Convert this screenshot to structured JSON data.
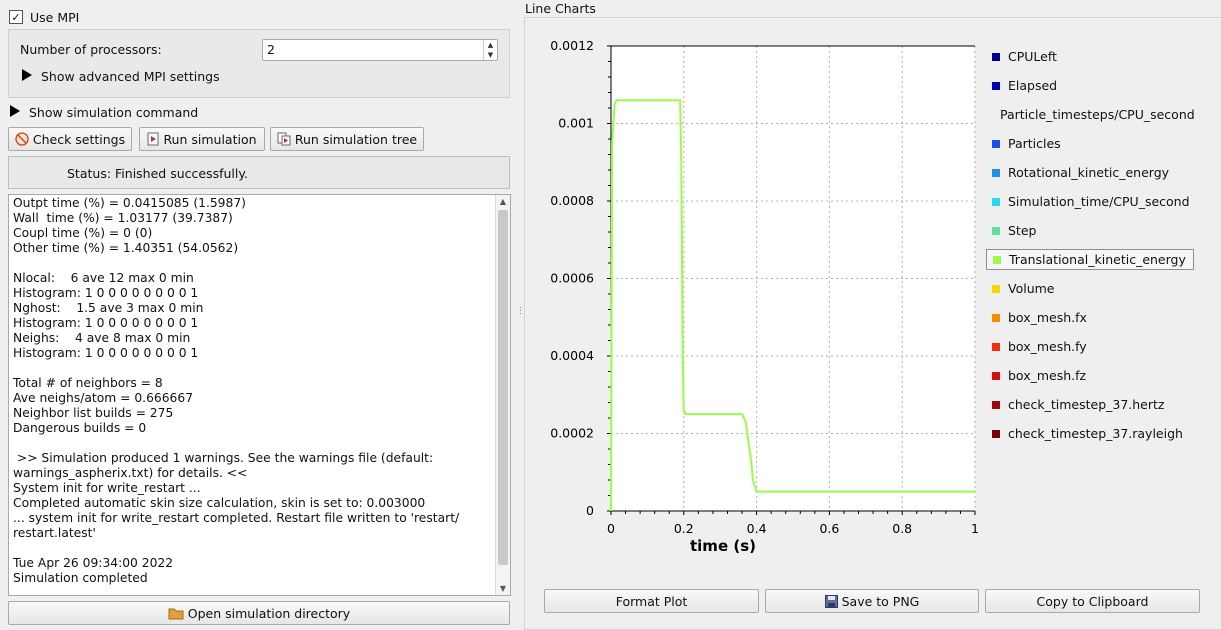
{
  "mpi": {
    "use_mpi_label": "Use MPI",
    "use_mpi_checked": true,
    "check_mark": "✓",
    "processors_label": "Number of processors:",
    "processors_value": "2",
    "advanced_label": "Show advanced MPI settings"
  },
  "simulation_command_label": "Show simulation command",
  "toolbar": {
    "check_settings": "Check settings",
    "run_simulation": "Run simulation",
    "run_simulation_tree": "Run simulation tree"
  },
  "status_text": "Status: Finished successfully.",
  "log_lines": [
    "Outpt time (%) = 0.0415085 (1.5987)",
    "Wall  time (%) = 1.03177 (39.7387)",
    "Coupl time (%) = 0 (0)",
    "Other time (%) = 1.40351 (54.0562)",
    "",
    "Nlocal:    6 ave 12 max 0 min",
    "Histogram: 1 0 0 0 0 0 0 0 0 1",
    "Nghost:    1.5 ave 3 max 0 min",
    "Histogram: 1 0 0 0 0 0 0 0 0 1",
    "Neighs:    4 ave 8 max 0 min",
    "Histogram: 1 0 0 0 0 0 0 0 0 1",
    "",
    "Total # of neighbors = 8",
    "Ave neighs/atom = 0.666667",
    "Neighbor list builds = 275",
    "Dangerous builds = 0",
    "",
    " >> Simulation produced 1 warnings. See the warnings file (default:",
    "warnings_aspherix.txt) for details. <<",
    "System init for write_restart ...",
    "Completed automatic skin size calculation, skin is set to: 0.003000",
    "... system init for write_restart completed. Restart file written to 'restart/",
    "restart.latest'",
    "",
    "Tue Apr 26 09:34:00 2022",
    "Simulation completed"
  ],
  "open_directory_label": "Open simulation directory",
  "chart_panel_title": "Line Charts",
  "legend": [
    {
      "label": "CPULeft",
      "color": "#00008b"
    },
    {
      "label": "Elapsed",
      "color": "#0000b8"
    },
    {
      "label": "Particle_timesteps/CPU_second",
      "color": "#0a1fd8"
    },
    {
      "label": "Particles",
      "color": "#1a4ff0"
    },
    {
      "label": "Rotational_kinetic_energy",
      "color": "#1e90e8"
    },
    {
      "label": "Simulation_time/CPU_second",
      "color": "#28d8f0"
    },
    {
      "label": "Step",
      "color": "#60e0a0"
    },
    {
      "label": "Translational_kinetic_energy",
      "color": "#9afc48",
      "selected": true
    },
    {
      "label": "Volume",
      "color": "#f5d800"
    },
    {
      "label": "box_mesh.fx",
      "color": "#f98a00"
    },
    {
      "label": "box_mesh.fy",
      "color": "#f03010"
    },
    {
      "label": "box_mesh.fz",
      "color": "#d41010"
    },
    {
      "label": "check_timestep_37.hertz",
      "color": "#a00808"
    },
    {
      "label": "check_timestep_37.rayleigh",
      "color": "#7a0000"
    }
  ],
  "chart_data": {
    "type": "line",
    "title": "",
    "xlabel": "time (s)",
    "ylabel": "",
    "xlim": [
      0,
      1
    ],
    "ylim": [
      0,
      0.0012
    ],
    "x_ticks": [
      "0",
      "0.2",
      "0.4",
      "0.6",
      "0.8",
      "1"
    ],
    "y_ticks": [
      "0",
      "0.0002",
      "0.0004",
      "0.0006",
      "0.0008",
      "0.001",
      "0.0012"
    ],
    "grid": true,
    "legend_placement": "right",
    "series": [
      {
        "name": "Translational_kinetic_energy",
        "color": "#9afc48",
        "x": [
          0,
          0.003,
          0.01,
          0.015,
          0.19,
          0.193,
          0.197,
          0.2,
          0.205,
          0.3,
          0.36,
          0.37,
          0.385,
          0.39,
          0.4,
          0.5,
          0.7,
          1.0
        ],
        "y": [
          0,
          0.00095,
          0.00105,
          0.00106,
          0.00106,
          0.0009,
          0.0004,
          0.00026,
          0.00025,
          0.00025,
          0.00025,
          0.00023,
          0.00013,
          8e-05,
          5e-05,
          5e-05,
          5e-05,
          5e-05
        ]
      }
    ]
  },
  "chart_buttons": {
    "format_plot": "Format Plot",
    "save_png": "Save to PNG",
    "copy_clipboard": "Copy to Clipboard"
  }
}
